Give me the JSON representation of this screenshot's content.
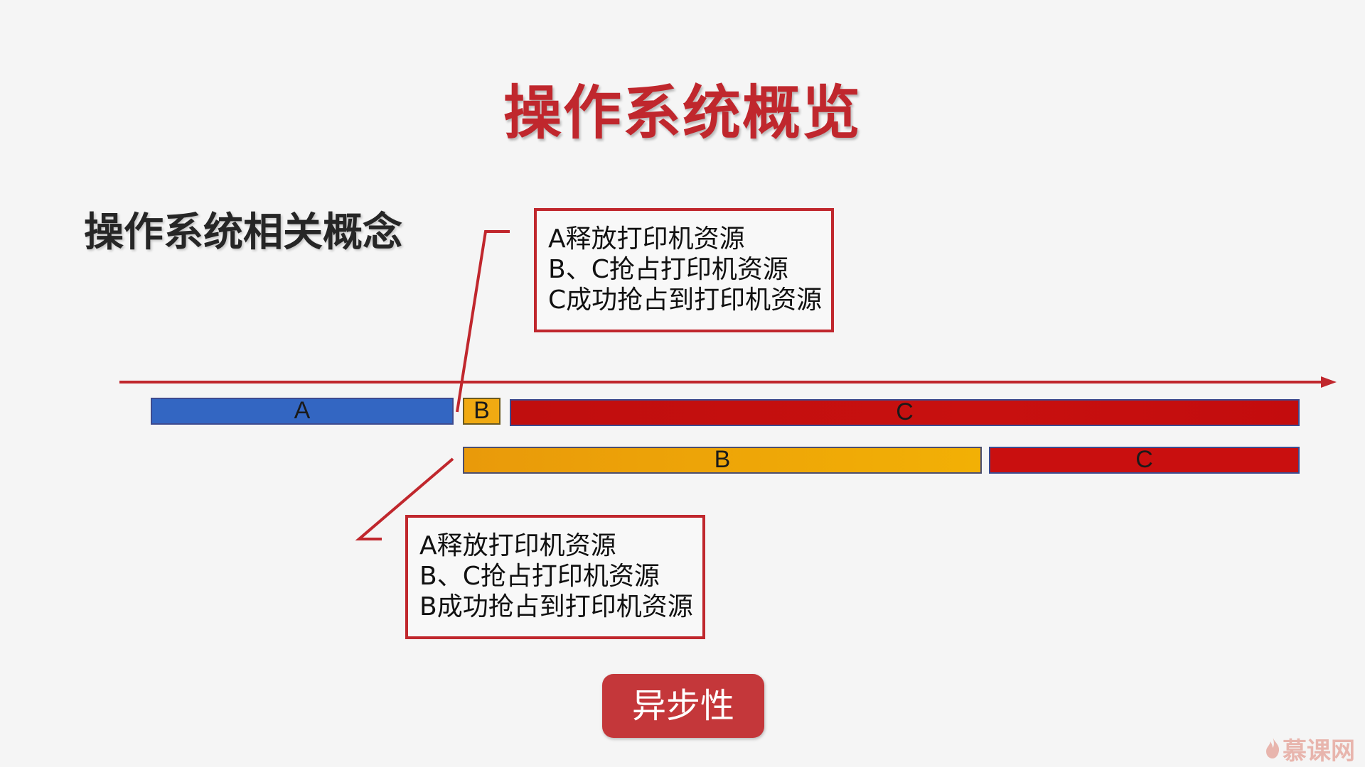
{
  "title": "操作系统概览",
  "section_title": "操作系统相关概念",
  "callout_top": {
    "lines": [
      "A释放打印机资源",
      "B、C抢占打印机资源",
      "C成功抢占到打印机资源"
    ]
  },
  "callout_bottom": {
    "lines": [
      "A释放打印机资源",
      "B、C抢占打印机资源",
      "B成功抢占到打印机资源"
    ]
  },
  "timeline": {
    "row1": [
      {
        "label": "A",
        "color": "#3366c2"
      },
      {
        "label": "B",
        "color": "#f0aa12"
      },
      {
        "label": "C",
        "color": "#c00e0e"
      }
    ],
    "row2": [
      {
        "label": "B",
        "color": "#f0aa12"
      },
      {
        "label": "C",
        "color": "#c90f0f"
      }
    ],
    "axis_color": "#c0272d"
  },
  "badge": "异步性",
  "watermark": {
    "text": "慕课网",
    "icon": "flame-icon"
  }
}
